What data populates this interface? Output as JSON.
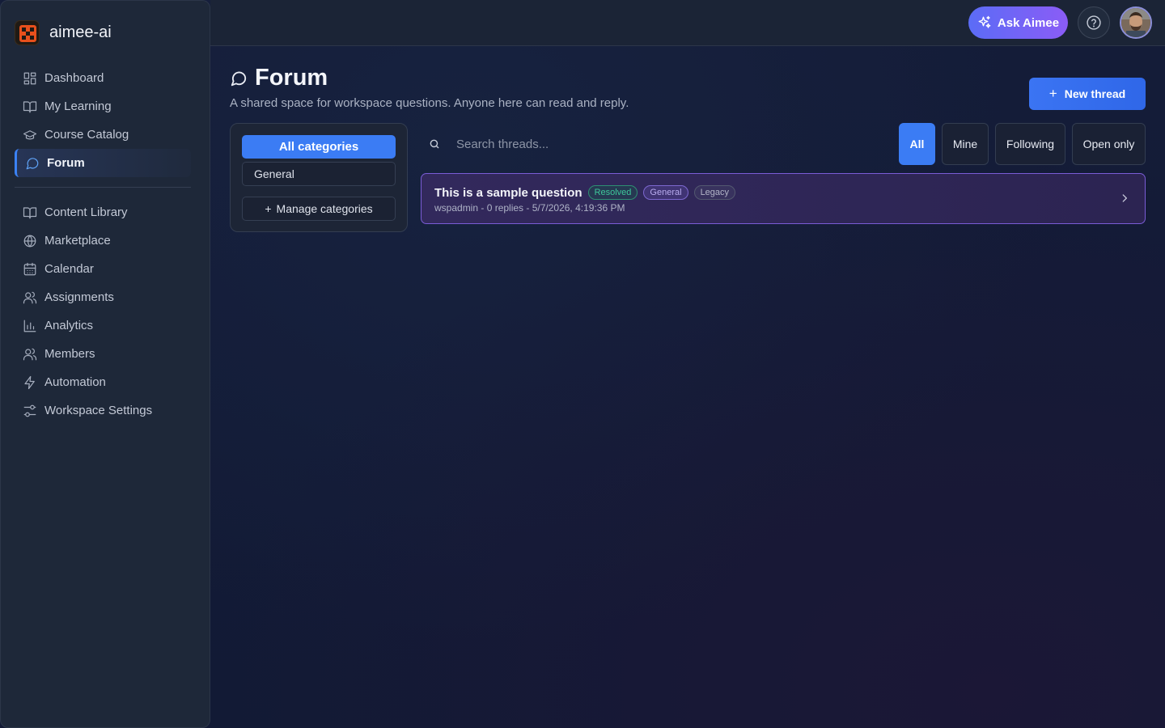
{
  "brand": {
    "name": "aimee-ai"
  },
  "sidebar": {
    "primary": [
      {
        "label": "Dashboard",
        "icon": "dashboard-icon"
      },
      {
        "label": "My Learning",
        "icon": "book-open-icon"
      },
      {
        "label": "Course Catalog",
        "icon": "graduation-cap-icon"
      },
      {
        "label": "Forum",
        "icon": "message-circle-icon",
        "active": true
      }
    ],
    "secondary": [
      {
        "label": "Content Library",
        "icon": "book-open-icon"
      },
      {
        "label": "Marketplace",
        "icon": "globe-icon"
      },
      {
        "label": "Calendar",
        "icon": "calendar-icon"
      },
      {
        "label": "Assignments",
        "icon": "users-icon"
      },
      {
        "label": "Analytics",
        "icon": "bar-chart-icon"
      },
      {
        "label": "Members",
        "icon": "users-icon"
      },
      {
        "label": "Automation",
        "icon": "zap-icon"
      },
      {
        "label": "Workspace Settings",
        "icon": "sliders-icon"
      }
    ]
  },
  "topbar": {
    "ask_label": "Ask Aimee"
  },
  "header": {
    "title": "Forum",
    "subtitle": "A shared space for workspace questions. Anyone here can read and reply.",
    "new_thread_label": "New thread"
  },
  "categories": {
    "all_label": "All categories",
    "items": [
      "General"
    ],
    "manage_label": "Manage categories"
  },
  "search": {
    "placeholder": "Search threads..."
  },
  "filters": [
    {
      "label": "All",
      "active": true
    },
    {
      "label": "Mine",
      "active": false
    },
    {
      "label": "Following",
      "active": false
    },
    {
      "label": "Open only",
      "active": false
    }
  ],
  "threads": [
    {
      "title": "This is a sample question",
      "badges": [
        "Resolved",
        "General",
        "Legacy"
      ],
      "meta": "wspadmin - 0 replies - 5/7/2026, 4:19:36 PM"
    }
  ],
  "colors": {
    "accent": "#3b7cf4",
    "ask_gradient_start": "#5b6cf6",
    "ask_gradient_end": "#8b5cf6",
    "resolved": "#3ec79a"
  }
}
